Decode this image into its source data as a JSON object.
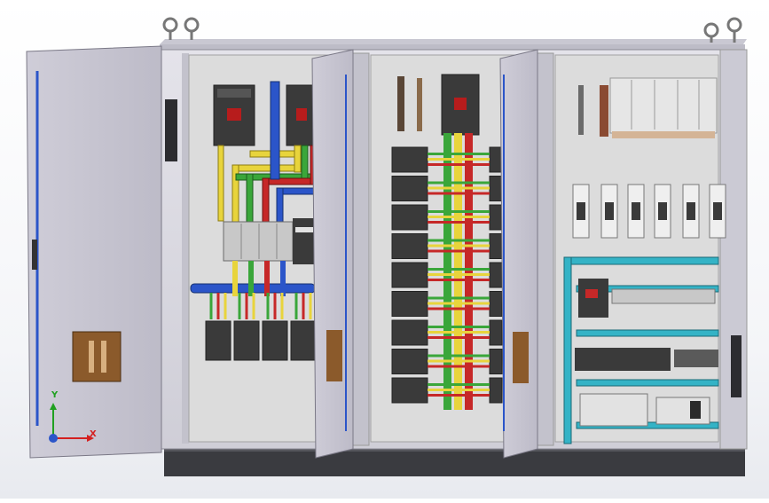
{
  "viewport": {
    "axis_labels": {
      "x": "X",
      "y": "Y"
    },
    "background_color": "#ffffff"
  },
  "model": {
    "enclosure_color": "#d9d8e0",
    "panel_color": "#dcdcdc",
    "plinth_color": "#3a3b40",
    "busbar_colors": [
      "#e8d43c",
      "#3aa63a",
      "#c62828",
      "#2b55c9"
    ],
    "breaker_color": "#3a3a3a",
    "terminal_color": "#5a4636",
    "dinrail_color": "#34b3c6"
  }
}
